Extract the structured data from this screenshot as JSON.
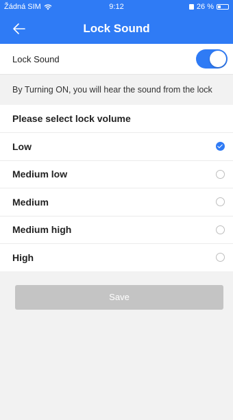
{
  "status_bar": {
    "carrier": "Žádná SIM",
    "time": "9:12",
    "battery": "26 %",
    "battery_level": 0.26
  },
  "nav": {
    "title": "Lock Sound"
  },
  "lock_sound": {
    "label": "Lock Sound",
    "enabled": true
  },
  "description": "By Turning ON, you will hear the sound from the lock",
  "volume": {
    "header": "Please select lock volume",
    "options": [
      {
        "label": "Low",
        "selected": true
      },
      {
        "label": "Medium low",
        "selected": false
      },
      {
        "label": "Medium",
        "selected": false
      },
      {
        "label": "Medium high",
        "selected": false
      },
      {
        "label": "High",
        "selected": false
      }
    ]
  },
  "save_label": "Save",
  "colors": {
    "accent": "#2f7bf5",
    "disabled_button": "#c4c4c4",
    "background": "#f2f2f2"
  }
}
